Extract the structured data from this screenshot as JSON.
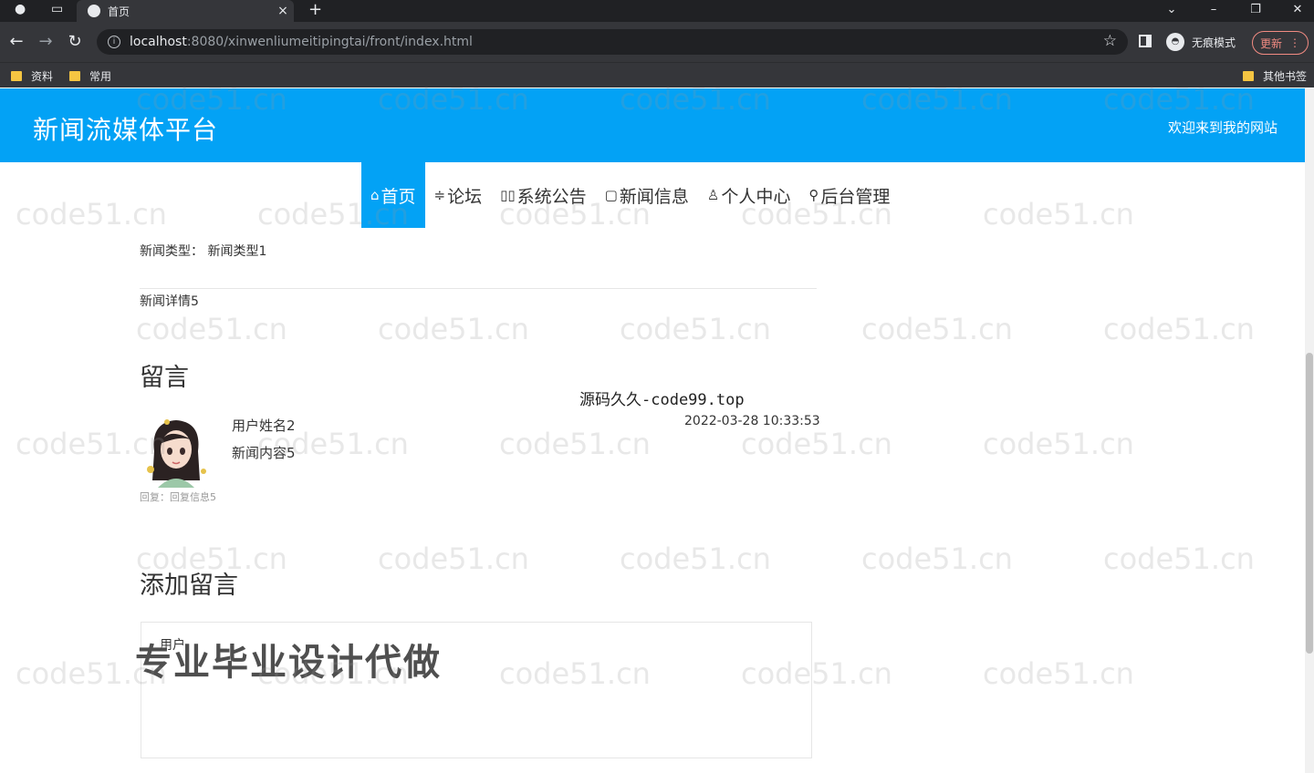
{
  "browser": {
    "tab_title": "首页",
    "tab_close": "×",
    "new_tab": "+",
    "url_host": "localhost",
    "url_path": ":8080/xinwenliumeitipingtai/front/index.html",
    "incognito_label": "无痕模式",
    "update_label": "更新",
    "bookmarks": [
      "资料",
      "常用"
    ],
    "other_bookmarks": "其他书签"
  },
  "site": {
    "title": "新闻流媒体平台",
    "welcome": "欢迎来到我的网站"
  },
  "nav": [
    {
      "label": "首页",
      "icon": "⌂",
      "active": true
    },
    {
      "label": "论坛",
      "icon": "≑",
      "active": false
    },
    {
      "label": "系统公告",
      "icon": "▯▯",
      "active": false
    },
    {
      "label": "新闻信息",
      "icon": "▢",
      "active": false
    },
    {
      "label": "个人中心",
      "icon": "♙",
      "active": false
    },
    {
      "label": "后台管理",
      "icon": "⚲",
      "active": false
    }
  ],
  "detail": {
    "type_label": "新闻类型：",
    "type_value": "新闻类型1",
    "content": "新闻详情5"
  },
  "comments": {
    "title": "留言",
    "items": [
      {
        "user": "用户姓名2",
        "text": "新闻内容5",
        "time": "2022-03-28 10:33:53",
        "reply": "回复：回复信息5"
      }
    ]
  },
  "add_comment": {
    "title": "添加留言",
    "user_label": "用户"
  },
  "overlay": {
    "site_tag": "源码久久-code99.top",
    "promo": "专业毕业设计代做",
    "watermark": "code51.cn"
  }
}
